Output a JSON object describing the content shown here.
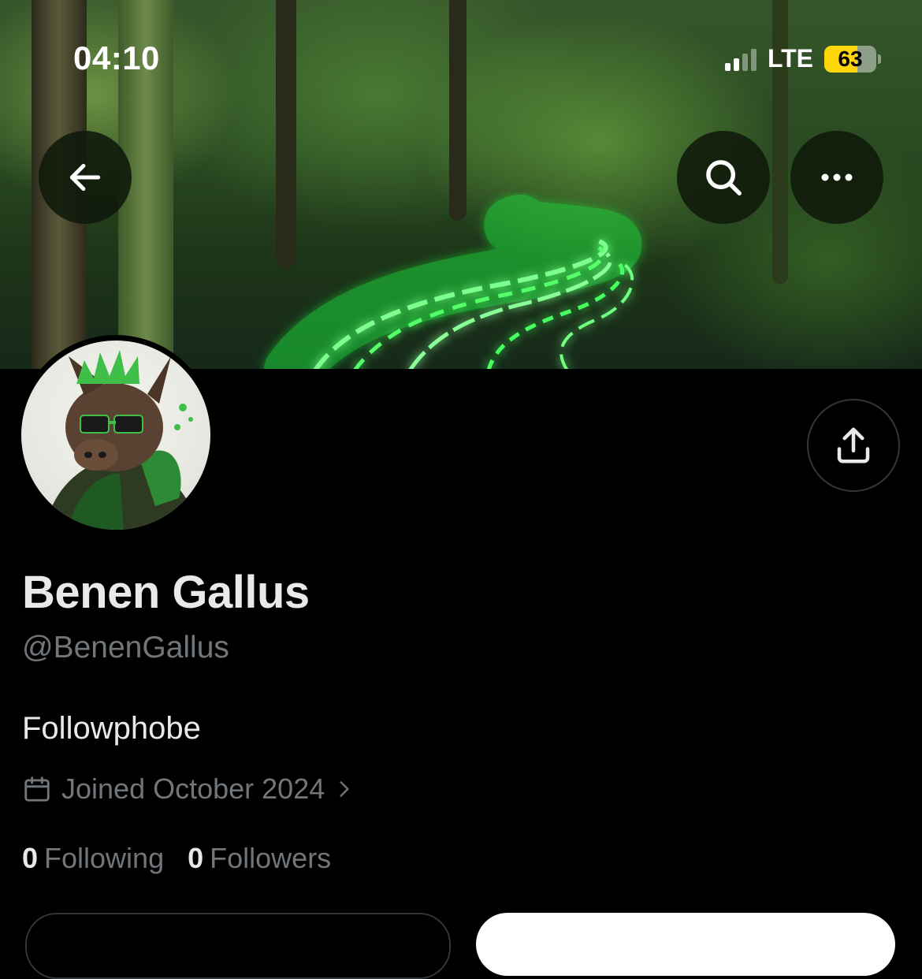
{
  "status_bar": {
    "time": "04:10",
    "network": "LTE",
    "battery": "63",
    "battery_level": 0.63,
    "signal_bars_active": 2
  },
  "header": {
    "back_icon": "arrow-left-icon",
    "search_icon": "search-icon",
    "more_icon": "more-horizontal-icon"
  },
  "profile": {
    "display_name": "Benen Gallus",
    "handle": "@BenenGallus",
    "bio": "Followphobe",
    "joined": "Joined October 2024",
    "following_count": "0",
    "following_label": "Following",
    "followers_count": "0",
    "followers_label": "Followers"
  },
  "colors": {
    "background": "#000000",
    "primary_text": "#e7e9ea",
    "secondary_text": "#71767b",
    "accent_green": "#39ff5a"
  }
}
